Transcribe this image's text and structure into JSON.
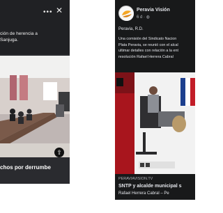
{
  "left_post": {
    "text_lines": [
      "ción de herencia a",
      "Sanjuga."
    ],
    "caption": "chos por derrumbe"
  },
  "right_post": {
    "page_name": "Peravia Visión",
    "time": "6 d · ",
    "location": "Peravia, R.D.",
    "body_lines": [
      "Una comisión del Sindicato Nacion",
      "Plata Peravia, se reunió con el alcal",
      "ultimar detalles con relación a la ent",
      "resolución Rafael Herrera Cabral"
    ],
    "link_domain": "PERAVIAVISION.TV",
    "link_title": "SNTP y alcalde municipal s",
    "link_subtitle": "Rafael Herrera Cabral – Pe"
  }
}
